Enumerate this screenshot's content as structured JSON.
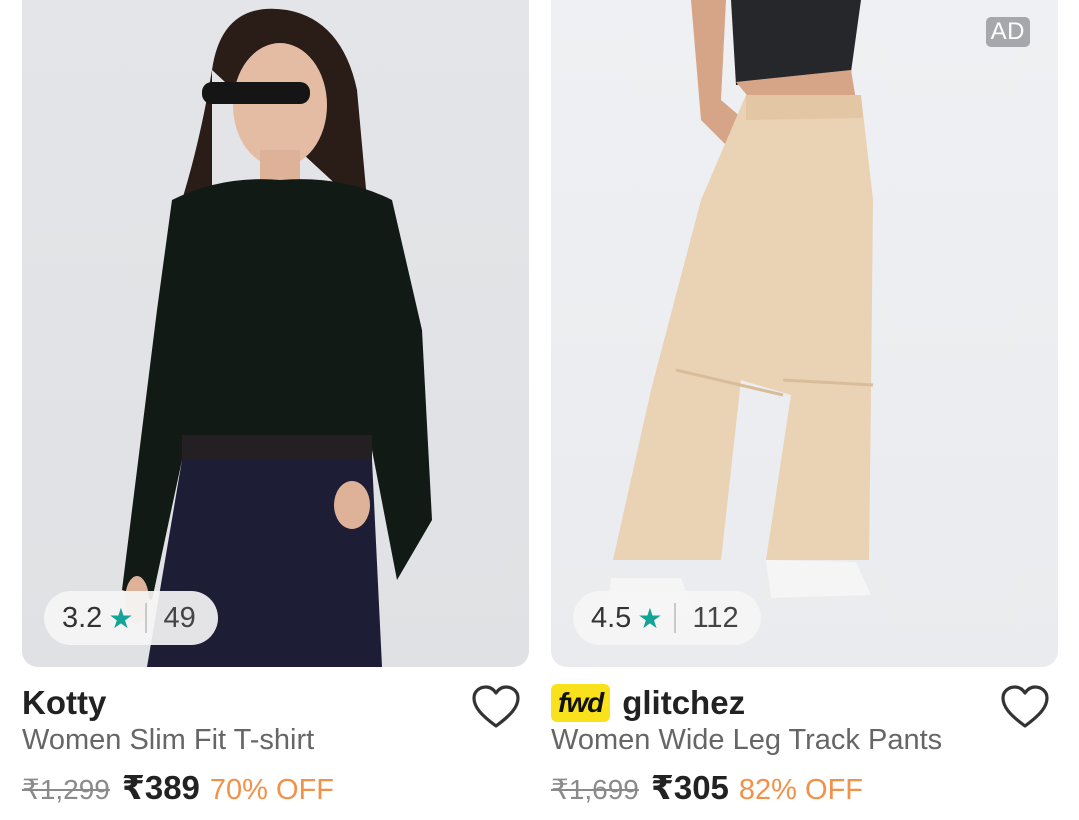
{
  "products": [
    {
      "brand": "Kotty",
      "title": "Women Slim Fit T-shirt",
      "mrp": "₹1,299",
      "price": "₹389",
      "discount": "70% OFF",
      "rating": "3.2",
      "rating_count": "49",
      "star_icon": "★",
      "is_ad": false
    },
    {
      "brand": "glitchez",
      "brand_badge": "fwd",
      "title": "Women Wide Leg Track Pants",
      "mrp": "₹1,699",
      "price": "₹305",
      "discount": "82% OFF",
      "rating": "4.5",
      "rating_count": "112",
      "star_icon": "★",
      "is_ad": true,
      "ad_label": "AD"
    }
  ],
  "colors": {
    "star": "#14a397",
    "discount": "#f2924a",
    "fwd_badge": "#f9e21b",
    "ad_badge": "#a6a8ab"
  }
}
